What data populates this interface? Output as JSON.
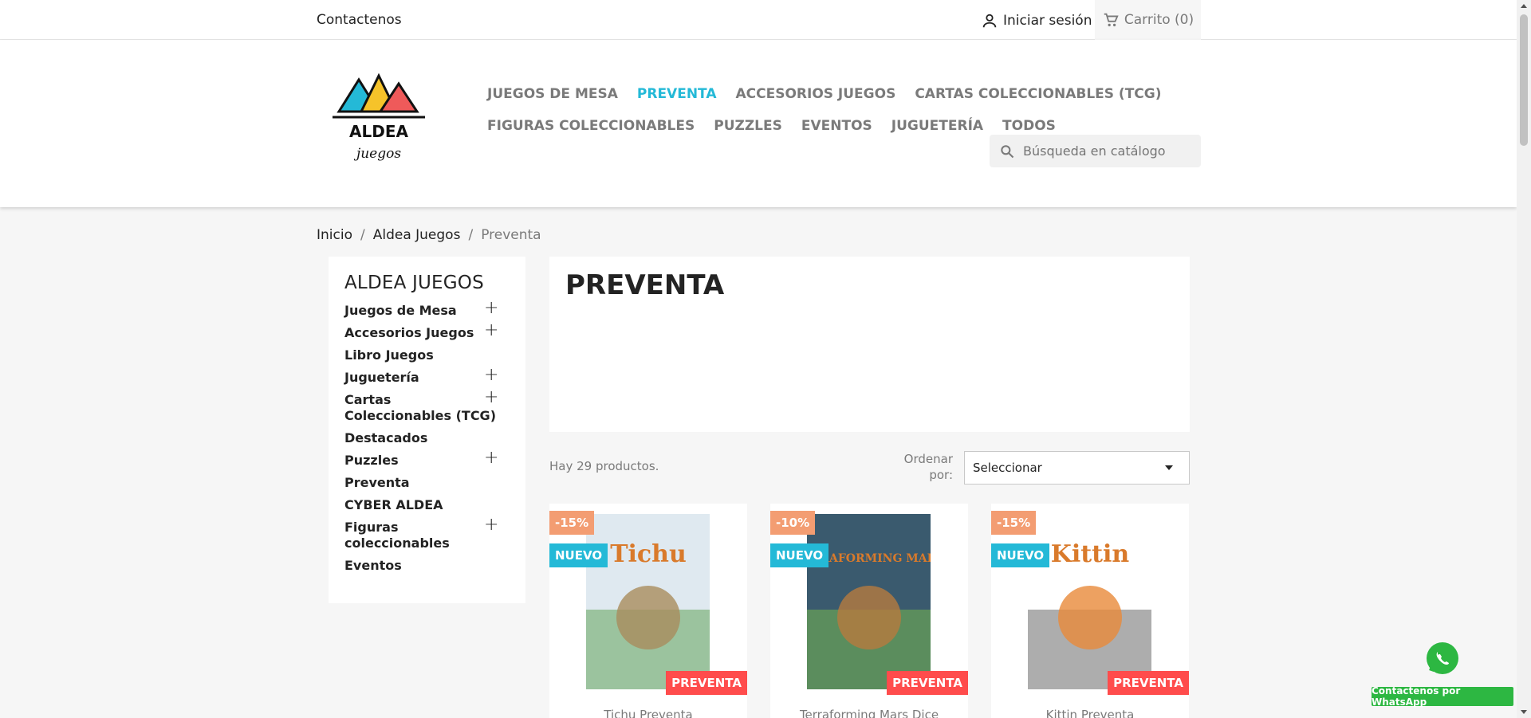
{
  "topbar": {
    "contact": "Contactenos",
    "signin": "Iniciar sesión",
    "cart": "Carrito (0)"
  },
  "logo": {
    "text": "ALDEA",
    "subtext": "juegos"
  },
  "nav": {
    "row1": [
      "JUEGOS DE MESA",
      "PREVENTA",
      "ACCESORIOS JUEGOS",
      "CARTAS COLECCIONABLES (TCG)"
    ],
    "row2": [
      "FIGURAS COLECCIONABLES",
      "PUZZLES",
      "EVENTOS",
      "JUGUETERÍA",
      "TODOS"
    ],
    "active": "PREVENTA"
  },
  "search": {
    "placeholder": "Búsqueda en catálogo"
  },
  "breadcrumb": [
    "Inicio",
    "Aldea Juegos",
    "Preventa"
  ],
  "sidebar": {
    "title": "ALDEA JUEGOS",
    "items": [
      {
        "label": "Juegos de Mesa",
        "expandable": true
      },
      {
        "label": "Accesorios Juegos",
        "expandable": true
      },
      {
        "label": "Libro Juegos",
        "expandable": false
      },
      {
        "label": "Juguetería",
        "expandable": true
      },
      {
        "label": "Cartas Coleccionables (TCG)",
        "expandable": true
      },
      {
        "label": "Destacados",
        "expandable": false
      },
      {
        "label": "Puzzles",
        "expandable": true
      },
      {
        "label": "Preventa",
        "expandable": false
      },
      {
        "label": "CYBER ALDEA",
        "expandable": false
      },
      {
        "label": "Figuras coleccionables",
        "expandable": true
      },
      {
        "label": "Eventos",
        "expandable": false
      }
    ]
  },
  "main": {
    "title": "PREVENTA",
    "count": "Hay 29 productos.",
    "sort_label": "Ordenar por:",
    "sort_value": "Seleccionar"
  },
  "products": [
    {
      "discount": "-15%",
      "new": "NUEVO",
      "preorder": "PREVENTA",
      "art": "Tichu",
      "name": "Tichu Preventa",
      "colors": [
        "#dfe9f0",
        "#a98c5c",
        "#7db27b"
      ]
    },
    {
      "discount": "-10%",
      "new": "NUEVO",
      "preorder": "PREVENTA",
      "art": "TERRAFORMING MARS",
      "name": "Terraforming Mars Dice",
      "colors": [
        "#3a5a6e",
        "#b77a3f",
        "#6aa356"
      ]
    },
    {
      "discount": "-15%",
      "new": "NUEVO",
      "preorder": "PREVENTA",
      "art": "Kittin",
      "name": "Kittin Preventa",
      "colors": [
        "#ffffff",
        "#e8893a",
        "#8a8a8a"
      ]
    }
  ],
  "whatsapp": {
    "label": "Contactenos por WhatsApp"
  },
  "colors": {
    "accent": "#24b9d7",
    "discount": "#f39d72",
    "preorder": "#ff4c4c",
    "whatsapp": "#2db742"
  }
}
